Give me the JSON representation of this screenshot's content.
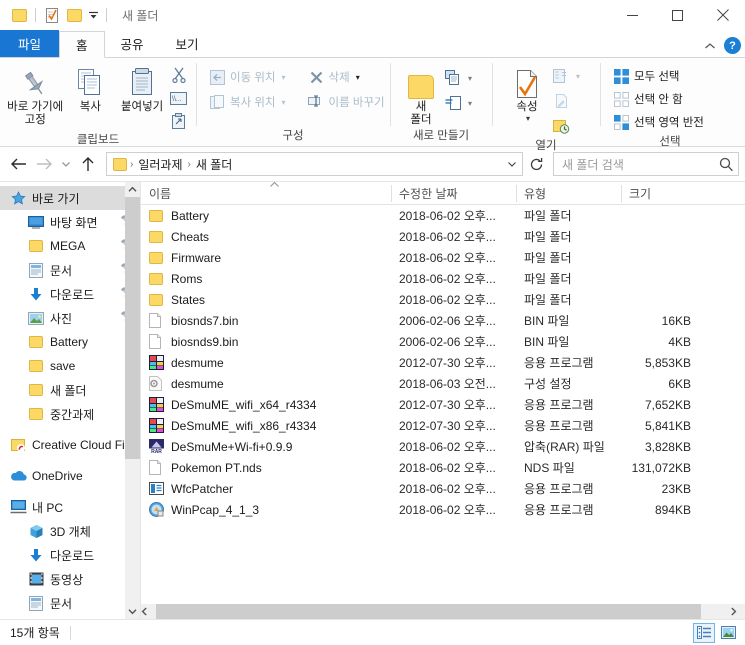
{
  "window": {
    "title": "새 폴더",
    "quick_access": [
      "folder-icon",
      "properties-icon",
      "new-folder-icon",
      "chevron-down-icon"
    ],
    "controls": {
      "minimize": "minimize-icon",
      "maximize": "maximize-icon",
      "close": "close-icon"
    }
  },
  "tabs": [
    {
      "label": "파일",
      "name": "tab-file"
    },
    {
      "label": "홈",
      "name": "tab-home"
    },
    {
      "label": "공유",
      "name": "tab-share"
    },
    {
      "label": "보기",
      "name": "tab-view"
    }
  ],
  "ribbon": {
    "collapse_icon": "chevron-up-icon",
    "help_icon": "help-icon",
    "help_label": "?",
    "groups": [
      {
        "title": "클립보드",
        "name": "ribbon-group-clipboard",
        "big": [
          {
            "label_line1": "바로 가기에",
            "label_line2": "고정",
            "icon": "pin-icon",
            "name": "pin-to-quick-access-button"
          },
          {
            "label_line1": "복사",
            "label_line2": "",
            "icon": "copy-icon",
            "name": "copy-button"
          },
          {
            "label_line1": "붙여넣기",
            "label_line2": "",
            "icon": "paste-icon",
            "name": "paste-button"
          }
        ],
        "mini": [
          {
            "icon": "cut-icon",
            "name": "cut-button"
          },
          {
            "icon": "copy-path-icon",
            "name": "copy-path-button"
          },
          {
            "icon": "paste-shortcut-icon",
            "name": "paste-shortcut-button"
          }
        ]
      },
      {
        "title": "구성",
        "name": "ribbon-group-organize",
        "small": [
          {
            "label": "이동 위치",
            "icon": "move-to-icon",
            "dropdown": true,
            "disabled": true,
            "name": "move-to-button"
          },
          {
            "label": "복사 위치",
            "icon": "copy-to-icon",
            "dropdown": true,
            "disabled": true,
            "name": "copy-to-button"
          }
        ],
        "small2": [
          {
            "label": "삭제",
            "icon": "delete-icon",
            "dropdown": true,
            "disabled": true,
            "name": "delete-button"
          },
          {
            "label": "이름 바꾸기",
            "icon": "rename-icon",
            "dropdown": false,
            "disabled": true,
            "name": "rename-button"
          }
        ]
      },
      {
        "title": "새로 만들기",
        "name": "ribbon-group-new",
        "big": [
          {
            "label_line1": "새",
            "label_line2": "폴더",
            "icon": "new-folder-icon",
            "name": "new-folder-button"
          }
        ],
        "small": [
          {
            "label": "",
            "icon": "new-item-icon",
            "dropdown": true,
            "name": "new-item-button"
          },
          {
            "label": "",
            "icon": "easy-access-icon",
            "dropdown": true,
            "name": "easy-access-button"
          }
        ]
      },
      {
        "title": "열기",
        "name": "ribbon-group-open",
        "big": [
          {
            "label_line1": "속성",
            "label_line2": "",
            "icon": "properties-icon",
            "dropdown": true,
            "name": "properties-button"
          }
        ],
        "small": [
          {
            "label": "",
            "icon": "open-icon",
            "dropdown": true,
            "disabled": true,
            "name": "open-button"
          },
          {
            "label": "",
            "icon": "edit-icon",
            "dropdown": false,
            "disabled": true,
            "name": "edit-button"
          },
          {
            "label": "",
            "icon": "history-icon",
            "dropdown": false,
            "name": "history-button"
          }
        ]
      },
      {
        "title": "선택",
        "name": "ribbon-group-select",
        "items": [
          {
            "label": "모두 선택",
            "icon": "select-all-icon",
            "name": "select-all-button"
          },
          {
            "label": "선택 안 함",
            "icon": "select-none-icon",
            "name": "select-none-button"
          },
          {
            "label": "선택 영역 반전",
            "icon": "invert-selection-icon",
            "name": "invert-selection-button"
          }
        ]
      }
    ]
  },
  "navbar": {
    "back": "back-arrow-icon",
    "forward": "forward-arrow-icon",
    "recent": "chevron-down-icon",
    "up": "up-arrow-icon",
    "breadcrumbs": [
      "일러과제",
      "새 폴더"
    ],
    "address_dropdown": "chevron-down-icon",
    "refresh": "refresh-icon",
    "search_placeholder": "새 폴더 검색",
    "search_value": "",
    "search_icon": "search-icon"
  },
  "navpane": {
    "scroll": {
      "up": "chevron-up-icon",
      "down": "chevron-down-icon"
    },
    "items": [
      {
        "label": "바로 가기",
        "icon": "star-icon",
        "level": 1,
        "selected": true,
        "pinned": false,
        "name": "sidebar-item-quick-access"
      },
      {
        "label": "바탕 화면",
        "icon": "desktop-icon",
        "level": 2,
        "pinned": true,
        "name": "sidebar-item-desktop"
      },
      {
        "label": "MEGA",
        "icon": "folder-icon",
        "level": 2,
        "pinned": true,
        "name": "sidebar-item-mega"
      },
      {
        "label": "문서",
        "icon": "documents-icon",
        "level": 2,
        "pinned": true,
        "name": "sidebar-item-documents"
      },
      {
        "label": "다운로드",
        "icon": "download-icon",
        "level": 2,
        "pinned": true,
        "name": "sidebar-item-downloads"
      },
      {
        "label": "사진",
        "icon": "pictures-icon",
        "level": 2,
        "pinned": true,
        "name": "sidebar-item-pictures"
      },
      {
        "label": "Battery",
        "icon": "folder-icon",
        "level": 2,
        "pinned": false,
        "name": "sidebar-item-battery"
      },
      {
        "label": "save",
        "icon": "folder-icon",
        "level": 2,
        "pinned": false,
        "name": "sidebar-item-save"
      },
      {
        "label": "새 폴더",
        "icon": "folder-icon",
        "level": 2,
        "pinned": false,
        "name": "sidebar-item-new-folder"
      },
      {
        "label": "중간과제",
        "icon": "folder-icon",
        "level": 2,
        "pinned": false,
        "name": "sidebar-item-midterm"
      },
      {
        "label": "Creative Cloud Fil",
        "icon": "creative-cloud-icon",
        "level": 1,
        "pinned": false,
        "name": "sidebar-item-creative-cloud"
      },
      {
        "label": "OneDrive",
        "icon": "onedrive-icon",
        "level": 1,
        "pinned": false,
        "name": "sidebar-item-onedrive"
      },
      {
        "label": "내 PC",
        "icon": "this-pc-icon",
        "level": 1,
        "pinned": false,
        "name": "sidebar-item-this-pc"
      },
      {
        "label": "3D 개체",
        "icon": "3d-objects-icon",
        "level": 2,
        "pinned": false,
        "name": "sidebar-item-3d-objects"
      },
      {
        "label": "다운로드",
        "icon": "download-icon",
        "level": 2,
        "pinned": false,
        "name": "sidebar-item-pc-downloads"
      },
      {
        "label": "동영상",
        "icon": "videos-icon",
        "level": 2,
        "pinned": false,
        "name": "sidebar-item-videos"
      },
      {
        "label": "문서",
        "icon": "documents-icon",
        "level": 2,
        "pinned": false,
        "name": "sidebar-item-pc-documents"
      }
    ]
  },
  "filelist": {
    "columns": [
      {
        "label": "이름",
        "name": "column-header-name",
        "sorted": true
      },
      {
        "label": "수정한 날짜",
        "name": "column-header-date"
      },
      {
        "label": "유형",
        "name": "column-header-type"
      },
      {
        "label": "크기",
        "name": "column-header-size"
      }
    ],
    "rows": [
      {
        "name": "Battery",
        "date": "2018-06-02 오후...",
        "type": "파일 폴더",
        "size": "",
        "icon": "folder-icon"
      },
      {
        "name": "Cheats",
        "date": "2018-06-02 오후...",
        "type": "파일 폴더",
        "size": "",
        "icon": "folder-icon"
      },
      {
        "name": "Firmware",
        "date": "2018-06-02 오후...",
        "type": "파일 폴더",
        "size": "",
        "icon": "folder-icon"
      },
      {
        "name": "Roms",
        "date": "2018-06-02 오후...",
        "type": "파일 폴더",
        "size": "",
        "icon": "folder-icon"
      },
      {
        "name": "States",
        "date": "2018-06-02 오후...",
        "type": "파일 폴더",
        "size": "",
        "icon": "folder-icon"
      },
      {
        "name": "biosnds7.bin",
        "date": "2006-02-06 오후...",
        "type": "BIN 파일",
        "size": "16KB",
        "icon": "generic-file-icon"
      },
      {
        "name": "biosnds9.bin",
        "date": "2006-02-06 오후...",
        "type": "BIN 파일",
        "size": "4KB",
        "icon": "generic-file-icon"
      },
      {
        "name": "desmume",
        "date": "2012-07-30 오후...",
        "type": "응용 프로그램",
        "size": "5,853KB",
        "icon": "desmume-app-icon"
      },
      {
        "name": "desmume",
        "date": "2018-06-03 오전...",
        "type": "구성 설정",
        "size": "6KB",
        "icon": "config-file-icon"
      },
      {
        "name": "DeSmuME_wifi_x64_r4334",
        "date": "2012-07-30 오후...",
        "type": "응용 프로그램",
        "size": "7,652KB",
        "icon": "desmume-app-icon"
      },
      {
        "name": "DeSmuME_wifi_x86_r4334",
        "date": "2012-07-30 오후...",
        "type": "응용 프로그램",
        "size": "5,841KB",
        "icon": "desmume-app-icon"
      },
      {
        "name": "DeSmuMe+Wi-fi+0.9.9",
        "date": "2018-06-02 오후...",
        "type": "압축(RAR) 파일",
        "size": "3,828KB",
        "icon": "rar-archive-icon"
      },
      {
        "name": "Pokemon PT.nds",
        "date": "2018-06-02 오후...",
        "type": "NDS 파일",
        "size": "131,072KB",
        "icon": "generic-file-icon"
      },
      {
        "name": "WfcPatcher",
        "date": "2018-06-02 오후...",
        "type": "응용 프로그램",
        "size": "23KB",
        "icon": "wfcpatcher-app-icon"
      },
      {
        "name": "WinPcap_4_1_3",
        "date": "2018-06-02 오후...",
        "type": "응용 프로그램",
        "size": "894KB",
        "icon": "installer-app-icon"
      }
    ]
  },
  "statusbar": {
    "item_count": "15개 항목",
    "views": [
      {
        "name": "details-view-button",
        "icon": "details-view-icon",
        "active": true
      },
      {
        "name": "large-icons-view-button",
        "icon": "large-icons-view-icon",
        "active": false
      }
    ]
  },
  "colors": {
    "accent": "#1976d2",
    "folder": "#fcd966",
    "selection": "#dcdcdc"
  }
}
